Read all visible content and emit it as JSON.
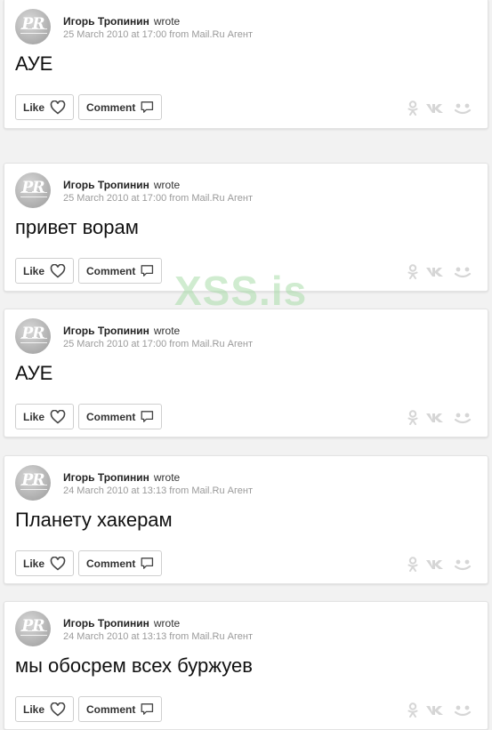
{
  "watermark": "XSS.is",
  "posts": [
    {
      "author": "Игорь Тропинин",
      "verb": "wrote",
      "date": "25 March 2010 at 17:00",
      "source": "from Mail.Ru Агент",
      "text": "АУЕ",
      "like_label": "Like",
      "comment_label": "Comment"
    },
    {
      "author": "Игорь Тропинин",
      "verb": "wrote",
      "date": "25 March 2010 at 17:00",
      "source": "from Mail.Ru Агент",
      "text": "привет ворам",
      "like_label": "Like",
      "comment_label": "Comment"
    },
    {
      "author": "Игорь Тропинин",
      "verb": "wrote",
      "date": "25 March 2010 at 17:00",
      "source": "from Mail.Ru Агент",
      "text": "АУЕ",
      "like_label": "Like",
      "comment_label": "Comment"
    },
    {
      "author": "Игорь Тропинин",
      "verb": "wrote",
      "date": "24 March 2010 at 13:13",
      "source": "from Mail.Ru Агент",
      "text": "Планету хакерам",
      "like_label": "Like",
      "comment_label": "Comment"
    },
    {
      "author": "Игорь Тропинин",
      "verb": "wrote",
      "date": "24 March 2010 at 13:13",
      "source": "from Mail.Ru Агент",
      "text": "мы обосрем всех буржуев",
      "like_label": "Like",
      "comment_label": "Comment"
    }
  ],
  "share_icons": [
    "odnoklassniki-icon",
    "vk-icon",
    "moimir-icon"
  ],
  "colors": {
    "share_icon": "#d6d6d6",
    "meta_text": "#9a9a9a"
  }
}
